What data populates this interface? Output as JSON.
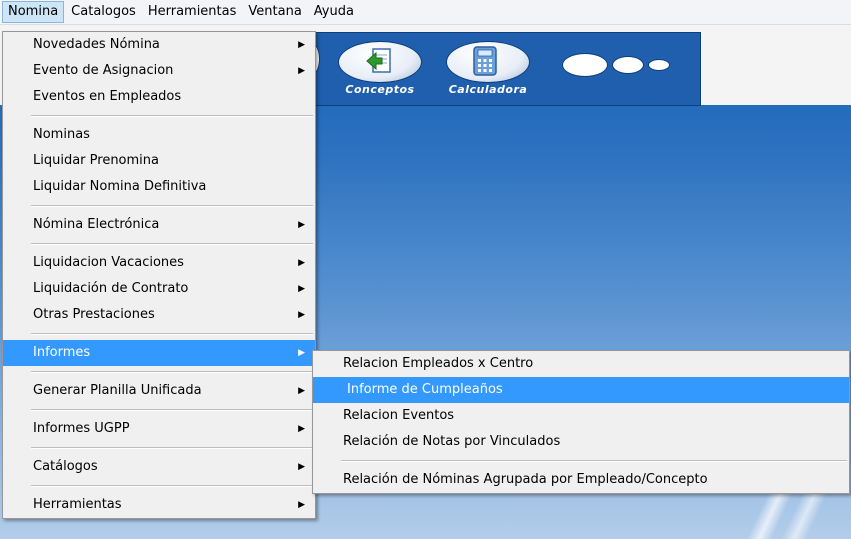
{
  "menubar": [
    "Nomina",
    "Catalogos",
    "Herramientas",
    "Ventana",
    "Ayuda"
  ],
  "toolbar": {
    "conceptos": "Conceptos",
    "calculadora": "Calculadora"
  },
  "nomina_menu": {
    "g1": [
      "Novedades Nómina",
      "Evento de Asignacion",
      "Eventos en Empleados"
    ],
    "g2": [
      "Nominas",
      "Liquidar Prenomina",
      "Liquidar Nomina Definitiva"
    ],
    "g3": [
      "Nómina Electrónica"
    ],
    "g4": [
      "Liquidacion Vacaciones",
      "Liquidación de Contrato",
      "Otras Prestaciones"
    ],
    "g5": [
      "Informes"
    ],
    "g6": [
      "Generar Planilla Unificada"
    ],
    "g7": [
      "Informes UGPP"
    ],
    "g8": [
      "Catálogos"
    ],
    "g9": [
      "Herramientas"
    ]
  },
  "informes_menu": [
    "Relacion Empleados x Centro",
    "Informe de Cumpleaños",
    "Relacion Eventos",
    "Relación de Notas por Vinculados",
    "Relación de Nóminas Agrupada por Empleado/Concepto"
  ],
  "colors": {
    "highlight": "#3399ff",
    "toolbar": "#1f5fae"
  }
}
